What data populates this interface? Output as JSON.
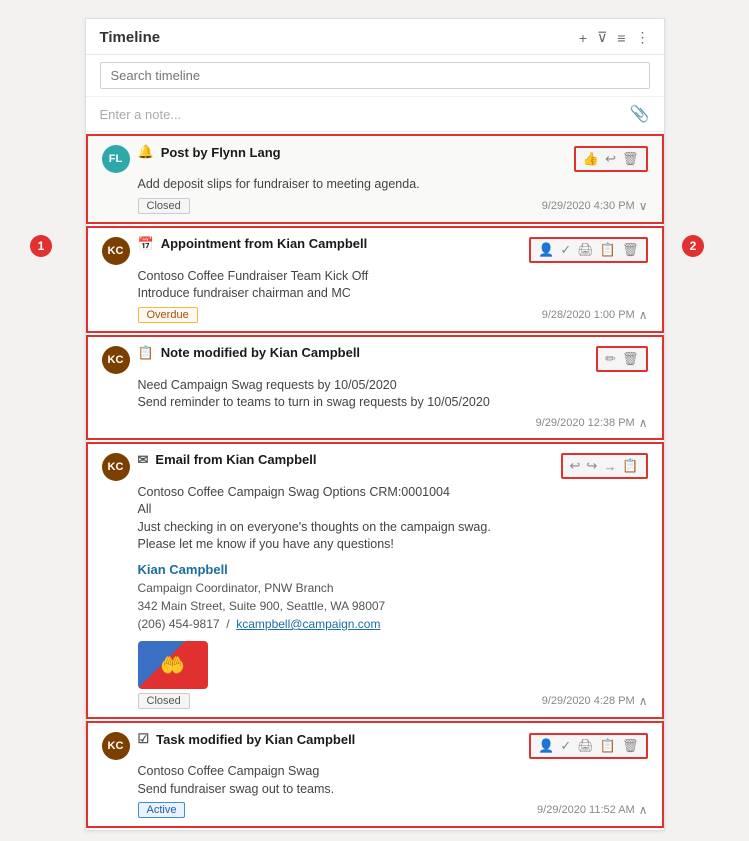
{
  "panel": {
    "title": "Timeline",
    "search_placeholder": "Search timeline",
    "note_placeholder": "Enter a note...",
    "header_icons": [
      "+",
      "⊽",
      "≡",
      "⋮"
    ]
  },
  "items": [
    {
      "id": "post-1",
      "type": "Post",
      "avatar": "FL",
      "avatar_class": "avatar-fl",
      "title": "Post by Flynn Lang",
      "body": "Add deposit slips for fundraiser to meeting agenda.",
      "badge": "Closed",
      "badge_type": "closed",
      "timestamp": "9/29/2020 4:30 PM",
      "actions": [
        "👍",
        "↩",
        "🗑"
      ],
      "expanded": true
    },
    {
      "id": "appt-1",
      "type": "Appointment",
      "avatar": "KC",
      "avatar_class": "avatar-kc",
      "title": "Appointment from Kian Campbell",
      "body_lines": [
        "Contoso Coffee Fundraiser Team Kick Off",
        "Introduce fundraiser chairman and MC"
      ],
      "badge": "Overdue",
      "badge_type": "overdue",
      "timestamp": "9/28/2020 1:00 PM",
      "actions": [
        "👤",
        "✓",
        "🖨",
        "📋",
        "🗑"
      ],
      "expanded": false
    },
    {
      "id": "note-1",
      "type": "Note",
      "avatar": "KC",
      "avatar_class": "avatar-kc",
      "title": "Note modified by Kian Campbell",
      "body_lines": [
        "Need Campaign Swag requests by 10/05/2020",
        "Send reminder to teams to turn in swag requests by 10/05/2020"
      ],
      "badge": null,
      "timestamp": "9/29/2020 12:38 PM",
      "actions": [
        "✏",
        "🗑"
      ],
      "expanded": false
    },
    {
      "id": "email-1",
      "type": "Email",
      "avatar": "KC",
      "avatar_class": "avatar-kc",
      "title": "Email from Kian Campbell",
      "body_lines": [
        "Contoso Coffee Campaign Swag Options CRM:0001004",
        "All",
        "Just checking in on everyone's thoughts on the campaign swag.",
        "Please let me know if you have any questions!"
      ],
      "signature": {
        "name": "Kian Campbell",
        "title": "Campaign Coordinator, PNW Branch",
        "address": "342 Main Street, Suite 900, Seattle, WA 98007",
        "phone": "(206) 454-9817",
        "email": "kcampbell@campaign.com"
      },
      "badge": "Closed",
      "badge_type": "closed",
      "timestamp": "9/29/2020 4:28 PM",
      "actions": [
        "↩",
        "↪",
        "→",
        "📋"
      ],
      "expanded": false
    },
    {
      "id": "task-1",
      "type": "Task",
      "avatar": "KC",
      "avatar_class": "avatar-kc",
      "title": "Task modified by Kian Campbell",
      "body_lines": [
        "Contoso Coffee Campaign Swag",
        "Send fundraiser swag out to teams."
      ],
      "badge": "Active",
      "badge_type": "active",
      "timestamp": "9/29/2020 11:52 AM",
      "actions": [
        "👤",
        "✓",
        "🖨",
        "📋",
        "🗑"
      ],
      "expanded": false
    }
  ],
  "annotations": {
    "circle1": "1",
    "circle2": "2"
  }
}
